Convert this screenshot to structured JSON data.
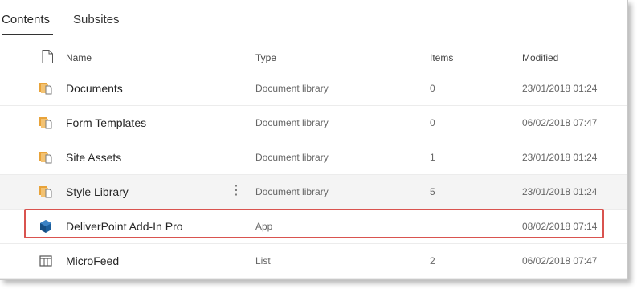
{
  "tabs": [
    {
      "label": "Contents",
      "active": true
    },
    {
      "label": "Subsites",
      "active": false
    }
  ],
  "columns": {
    "name": "Name",
    "type": "Type",
    "items": "Items",
    "modified": "Modified"
  },
  "rows": [
    {
      "name": "Documents",
      "type": "Document library",
      "items": "0",
      "modified": "23/01/2018 01:24",
      "icon": "document-library-icon"
    },
    {
      "name": "Form Templates",
      "type": "Document library",
      "items": "0",
      "modified": "06/02/2018 07:47",
      "icon": "document-library-icon"
    },
    {
      "name": "Site Assets",
      "type": "Document library",
      "items": "1",
      "modified": "23/01/2018 01:24",
      "icon": "document-library-icon"
    },
    {
      "name": "Style Library",
      "type": "Document library",
      "items": "5",
      "modified": "23/01/2018 01:24",
      "icon": "document-library-icon",
      "more_menu": "⋮"
    },
    {
      "name": "DeliverPoint Add-In Pro",
      "type": "App",
      "items": "",
      "modified": "08/02/2018 07:14",
      "icon": "app-cube-icon"
    },
    {
      "name": "MicroFeed",
      "type": "List",
      "items": "2",
      "modified": "06/02/2018 07:47",
      "icon": "list-icon"
    }
  ],
  "colors": {
    "library_icon": "#e8a33a",
    "app_icon": "#1b5e9c",
    "highlight_border": "#d9534f",
    "hover_row": "#f4f4f4"
  }
}
